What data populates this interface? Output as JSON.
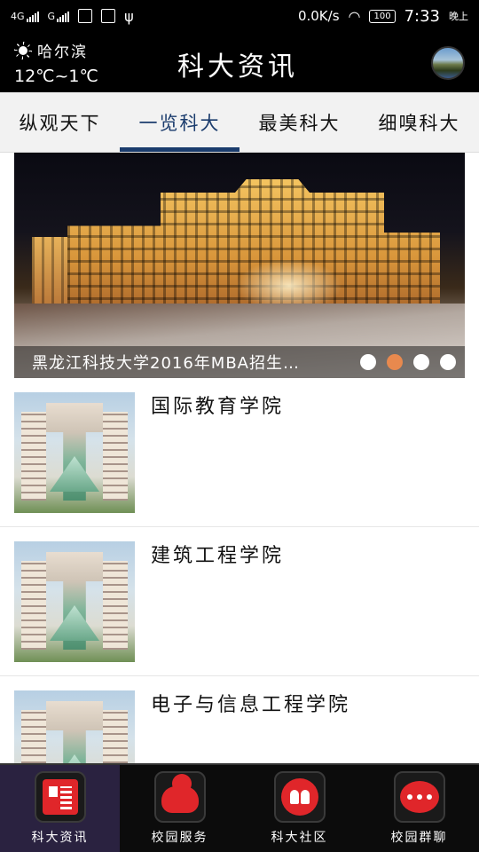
{
  "status_bar": {
    "signal1": "4G",
    "signal2": "G",
    "speed": "0.0K/s",
    "battery": "100",
    "time": "7:33",
    "period": "晚上"
  },
  "header": {
    "city": "哈尔滨",
    "temperature": "12℃~1℃",
    "title": "科大资讯",
    "weather_icon": "sun-icon"
  },
  "tabs": [
    {
      "label": "纵观天下",
      "active": false
    },
    {
      "label": "一览科大",
      "active": true
    },
    {
      "label": "最美科大",
      "active": false
    },
    {
      "label": "细嗅科大",
      "active": false
    }
  ],
  "banner": {
    "caption": "黑龙江科技大学2016年MBA招生…",
    "dot_count": 4,
    "active_dot": 1,
    "active_dot_color": "#e8894e"
  },
  "list": {
    "items": [
      {
        "title": "国际教育学院"
      },
      {
        "title": "建筑工程学院"
      },
      {
        "title": "电子与信息工程学院"
      }
    ]
  },
  "bottom_nav": {
    "items": [
      {
        "label": "科大资讯",
        "icon": "news-icon",
        "active": true
      },
      {
        "label": "校园服务",
        "icon": "cloud-icon",
        "active": false
      },
      {
        "label": "科大社区",
        "icon": "community-icon",
        "active": false
      },
      {
        "label": "校园群聊",
        "icon": "chat-bubble-icon",
        "active": false
      }
    ]
  },
  "colors": {
    "accent": "#1b3c6d",
    "nav_icon": "#e0262a",
    "nav_active_bg": "#2a2240"
  }
}
